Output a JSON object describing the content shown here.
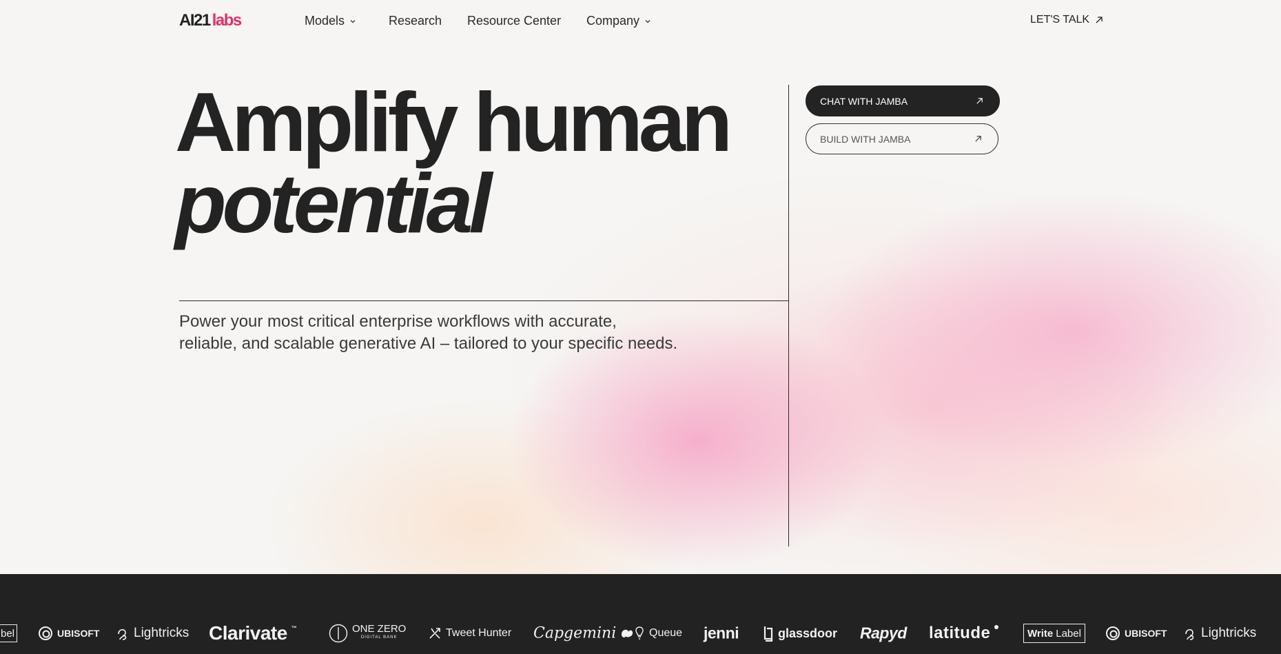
{
  "brand": {
    "logo_ai": "AI21",
    "logo_labs": "labs",
    "accent": "#e0306c"
  },
  "nav": {
    "items": [
      {
        "label": "Models",
        "dropdown": true
      },
      {
        "label": "Research",
        "dropdown": false
      },
      {
        "label": "Resource Center",
        "dropdown": false
      },
      {
        "label": "Company",
        "dropdown": true
      }
    ],
    "cta": "LET'S TALK"
  },
  "hero": {
    "headline_line1": "Amplify human",
    "headline_line2": "potential",
    "subtitle_line1": "Power your most critical enterprise workflows with accurate,",
    "subtitle_line2": "reliable, and scalable generative AI – tailored to your specific needs.",
    "primary_button": "CHAT WITH JAMBA",
    "secondary_button": "BUILD WITH JAMBA"
  },
  "customers": {
    "logos": [
      "bel",
      "UBISOFT",
      "Lightricks",
      "Clarivate",
      "ONE ZERO",
      "DIGITAL BANK",
      "Tweet Hunter",
      "Capgemini",
      "Queue",
      "jenni",
      "glassdoor",
      "Rapyd",
      "latitude",
      "Write",
      "Label",
      "UBISOFT",
      "Lightricks"
    ]
  },
  "colors": {
    "page_bg": "#f6f5f3",
    "dark": "#232323",
    "strip_bg": "#222222"
  }
}
